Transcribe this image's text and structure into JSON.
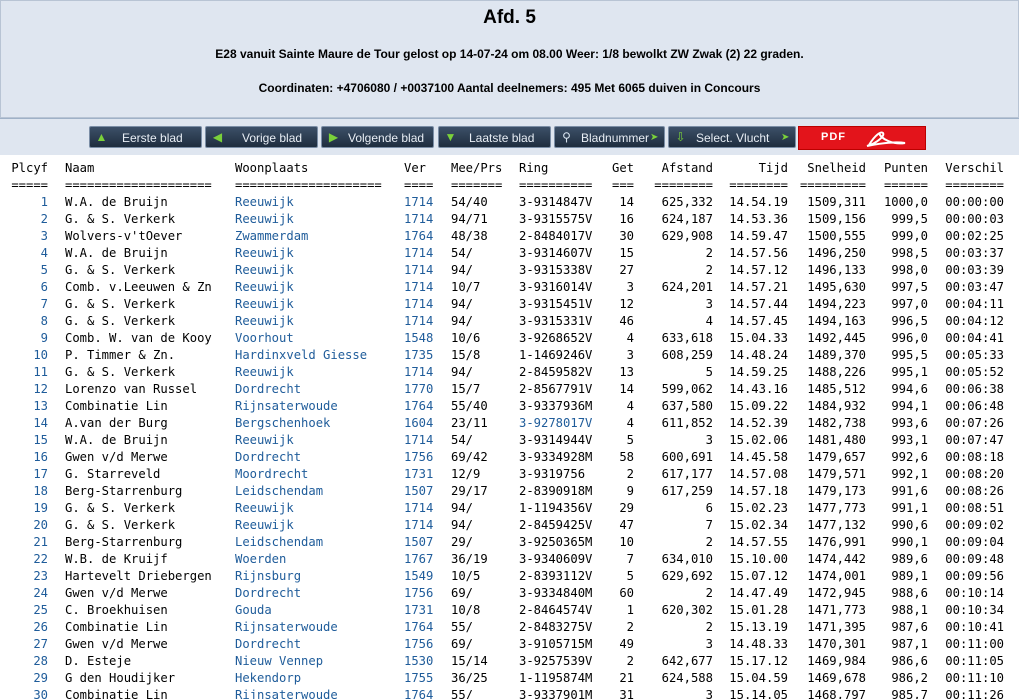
{
  "header": {
    "title": "Afd. 5",
    "line1": "E28 vanuit Sainte Maure de Tour gelost op 14-07-24 om 08.00 Weer: 1/8 bewolkt ZW Zwak (2) 22 graden.",
    "line2": "Coordinaten: +4706080 / +0037100 Aantal deelnemers: 495 Met 6065 duiven in Concours"
  },
  "nav": {
    "first": "Eerste blad",
    "prev": "Vorige blad",
    "next": "Volgende blad",
    "last": "Laatste blad",
    "page": "Bladnummer",
    "flight": "Select. Vlucht",
    "pdf": "PDF"
  },
  "columns": {
    "plcyf": "Plcyf",
    "naam": "Naam",
    "woonplaats": "Woonplaats",
    "ver": "Ver",
    "mee": "Mee/Prs",
    "ring": "Ring",
    "get": "Get",
    "afstand": "Afstand",
    "tijd": "Tijd",
    "snelheid": "Snelheid",
    "punten": "Punten",
    "verschil": "Verschil"
  },
  "separators": {
    "plcyf": "=====",
    "naam": "====================",
    "woonplaats": "====================",
    "ver": "====",
    "mee": "=======",
    "ring": "==========",
    "get": "===",
    "afstand": "========",
    "tijd": "========",
    "snelheid": "=========",
    "punten": "======",
    "verschil": "========"
  },
  "rows": [
    [
      "1",
      "W.A. de Bruijn",
      "Reeuwijk",
      "1714",
      "54/40",
      "3-9314847V",
      "14",
      "625,332",
      "14.54.19",
      "1509,311",
      "1000,0",
      "00:00:00"
    ],
    [
      "2",
      "G. & S. Verkerk",
      "Reeuwijk",
      "1714",
      "94/71",
      "3-9315575V",
      "16",
      "624,187",
      "14.53.36",
      "1509,156",
      "999,5",
      "00:00:03"
    ],
    [
      "3",
      "Wolvers-v'tOever",
      "Zwammerdam",
      "1764",
      "48/38",
      "2-8484017V",
      "30",
      "629,908",
      "14.59.47",
      "1500,555",
      "999,0",
      "00:02:25"
    ],
    [
      "4",
      "W.A. de Bruijn",
      "Reeuwijk",
      "1714",
      "54/",
      "3-9314607V",
      "15",
      "2",
      "14.57.56",
      "1496,250",
      "998,5",
      "00:03:37"
    ],
    [
      "5",
      "G. & S. Verkerk",
      "Reeuwijk",
      "1714",
      "94/",
      "3-9315338V",
      "27",
      "2",
      "14.57.12",
      "1496,133",
      "998,0",
      "00:03:39"
    ],
    [
      "6",
      "Comb. v.Leeuwen & Zn",
      "Reeuwijk",
      "1714",
      "10/7",
      "3-9316014V",
      "3",
      "624,201",
      "14.57.21",
      "1495,630",
      "997,5",
      "00:03:47"
    ],
    [
      "7",
      "G. & S. Verkerk",
      "Reeuwijk",
      "1714",
      "94/",
      "3-9315451V",
      "12",
      "3",
      "14.57.44",
      "1494,223",
      "997,0",
      "00:04:11"
    ],
    [
      "8",
      "G. & S. Verkerk",
      "Reeuwijk",
      "1714",
      "94/",
      "3-9315331V",
      "46",
      "4",
      "14.57.45",
      "1494,163",
      "996,5",
      "00:04:12"
    ],
    [
      "9",
      "Comb. W. van de Kooy",
      "Voorhout",
      "1548",
      "10/6",
      "3-9268652V",
      "4",
      "633,618",
      "15.04.33",
      "1492,445",
      "996,0",
      "00:04:41"
    ],
    [
      "10",
      "P. Timmer & Zn.",
      "Hardinxveld Giesse",
      "1735",
      "15/8",
      "1-1469246V",
      "3",
      "608,259",
      "14.48.24",
      "1489,370",
      "995,5",
      "00:05:33"
    ],
    [
      "11",
      "G. & S. Verkerk",
      "Reeuwijk",
      "1714",
      "94/",
      "2-8459582V",
      "13",
      "5",
      "14.59.25",
      "1488,226",
      "995,1",
      "00:05:52"
    ],
    [
      "12",
      "Lorenzo van Russel",
      "Dordrecht",
      "1770",
      "15/7",
      "2-8567791V",
      "14",
      "599,062",
      "14.43.16",
      "1485,512",
      "994,6",
      "00:06:38"
    ],
    [
      "13",
      "Combinatie Lin",
      "Rijnsaterwoude",
      "1764",
      "55/40",
      "3-9337936M",
      "4",
      "637,580",
      "15.09.22",
      "1484,932",
      "994,1",
      "00:06:48"
    ],
    [
      "14",
      "A.van der Burg",
      "Bergschenhoek",
      "1604",
      "23/11",
      "3-9278017V",
      "4",
      "611,852",
      "14.52.39",
      "1482,738",
      "993,6",
      "00:07:26"
    ],
    [
      "15",
      "W.A. de Bruijn",
      "Reeuwijk",
      "1714",
      "54/",
      "3-9314944V",
      "5",
      "3",
      "15.02.06",
      "1481,480",
      "993,1",
      "00:07:47"
    ],
    [
      "16",
      "Gwen v/d Merwe",
      "Dordrecht",
      "1756",
      "69/42",
      "3-9334928M",
      "58",
      "600,691",
      "14.45.58",
      "1479,657",
      "992,6",
      "00:08:18"
    ],
    [
      "17",
      "G. Starreveld",
      "Moordrecht",
      "1731",
      "12/9",
      "3-9319756",
      "2",
      "617,177",
      "14.57.08",
      "1479,571",
      "992,1",
      "00:08:20"
    ],
    [
      "18",
      "Berg-Starrenburg",
      "Leidschendam",
      "1507",
      "29/17",
      "2-8390918M",
      "9",
      "617,259",
      "14.57.18",
      "1479,173",
      "991,6",
      "00:08:26"
    ],
    [
      "19",
      "G. & S. Verkerk",
      "Reeuwijk",
      "1714",
      "94/",
      "1-1194356V",
      "29",
      "6",
      "15.02.23",
      "1477,773",
      "991,1",
      "00:08:51"
    ],
    [
      "20",
      "G. & S. Verkerk",
      "Reeuwijk",
      "1714",
      "94/",
      "2-8459425V",
      "47",
      "7",
      "15.02.34",
      "1477,132",
      "990,6",
      "00:09:02"
    ],
    [
      "21",
      "Berg-Starrenburg",
      "Leidschendam",
      "1507",
      "29/",
      "3-9250365M",
      "10",
      "2",
      "14.57.55",
      "1476,991",
      "990,1",
      "00:09:04"
    ],
    [
      "22",
      "W.B. de Kruijf",
      "Woerden",
      "1767",
      "36/19",
      "3-9340609V",
      "7",
      "634,010",
      "15.10.00",
      "1474,442",
      "989,6",
      "00:09:48"
    ],
    [
      "23",
      "Hartevelt Driebergen",
      "Rijnsburg",
      "1549",
      "10/5",
      "2-8393112V",
      "5",
      "629,692",
      "15.07.12",
      "1474,001",
      "989,1",
      "00:09:56"
    ],
    [
      "24",
      "Gwen v/d Merwe",
      "Dordrecht",
      "1756",
      "69/",
      "3-9334840M",
      "60",
      "2",
      "14.47.49",
      "1472,945",
      "988,6",
      "00:10:14"
    ],
    [
      "25",
      "C. Broekhuisen",
      "Gouda",
      "1731",
      "10/8",
      "2-8464574V",
      "1",
      "620,302",
      "15.01.28",
      "1471,773",
      "988,1",
      "00:10:34"
    ],
    [
      "26",
      "Combinatie Lin",
      "Rijnsaterwoude",
      "1764",
      "55/",
      "2-8483275V",
      "2",
      "2",
      "15.13.19",
      "1471,395",
      "987,6",
      "00:10:41"
    ],
    [
      "27",
      "Gwen v/d Merwe",
      "Dordrecht",
      "1756",
      "69/",
      "3-9105715M",
      "49",
      "3",
      "14.48.33",
      "1470,301",
      "987,1",
      "00:11:00"
    ],
    [
      "28",
      "D. Esteje",
      "Nieuw Vennep",
      "1530",
      "15/14",
      "3-9257539V",
      "2",
      "642,677",
      "15.17.12",
      "1469,984",
      "986,6",
      "00:11:05"
    ],
    [
      "29",
      "G den Houdijker",
      "Hekendorp",
      "1755",
      "36/25",
      "1-1195874M",
      "21",
      "624,588",
      "15.04.59",
      "1469,678",
      "986,2",
      "00:11:10"
    ],
    [
      "30",
      "Combinatie Lin",
      "Rijnsaterwoude",
      "1764",
      "55/",
      "3-9337901M",
      "31",
      "3",
      "15.14.05",
      "1468,797",
      "985,7",
      "00:11:26"
    ]
  ]
}
